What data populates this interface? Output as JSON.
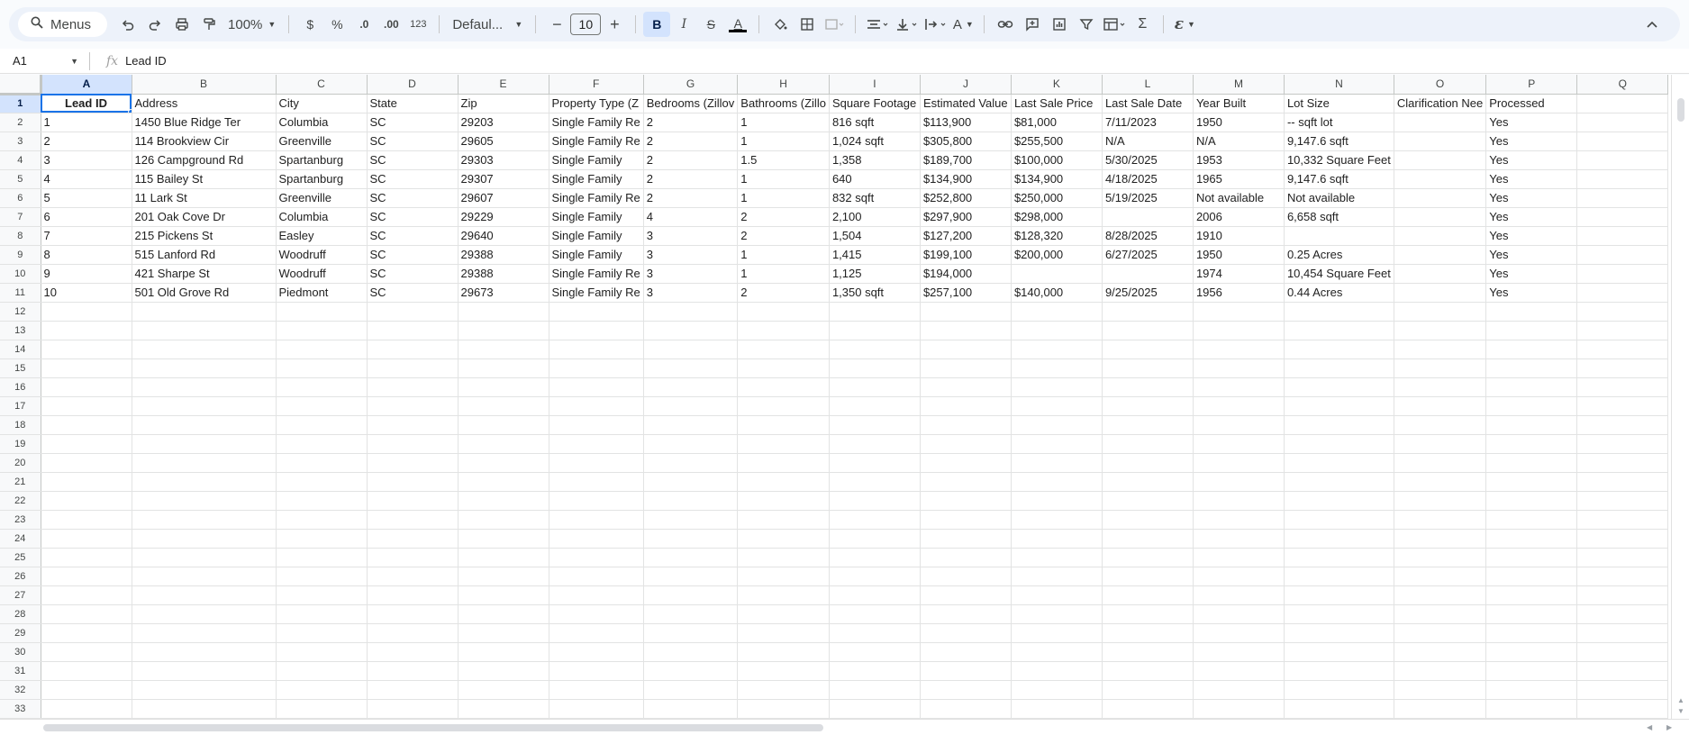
{
  "toolbar": {
    "menus_label": "Menus",
    "zoom": "100%",
    "currency": "$",
    "percent": "%",
    "decrease_decimal": ".0",
    "increase_decimal": ".00",
    "number_format": "123",
    "font": "Defaul...",
    "font_size": "10",
    "bold": "B",
    "italic": "I",
    "strike": "S",
    "text_color": "A",
    "text_rotation": "A",
    "functions": "Σ",
    "ai": "ε"
  },
  "formula_bar": {
    "cell_ref": "A1",
    "fx": "fx",
    "content": "Lead ID"
  },
  "columns": [
    "A",
    "B",
    "C",
    "D",
    "E",
    "F",
    "G",
    "H",
    "I",
    "J",
    "K",
    "L",
    "M",
    "N",
    "O",
    "P",
    "Q"
  ],
  "header_row": [
    "Lead ID",
    "Address",
    "City",
    "State",
    "Zip",
    "Property Type (Z",
    "Bedrooms (Zillov",
    "Bathrooms (Zillo",
    "Square Footage",
    "Estimated Value",
    "Last Sale Price",
    "Last Sale Date",
    "Year Built",
    "Lot Size",
    "Clarification Nee",
    "Processed",
    ""
  ],
  "rows": [
    [
      "1",
      "1450 Blue Ridge Ter",
      "Columbia",
      "SC",
      "29203",
      "Single Family Re",
      "2",
      "1",
      "816 sqft",
      "$113,900",
      "$81,000",
      "7/11/2023",
      "1950",
      "-- sqft lot",
      "",
      "Yes",
      ""
    ],
    [
      "2",
      "114 Brookview Cir",
      "Greenville",
      "SC",
      "29605",
      "Single Family Re",
      "2",
      "1",
      "1,024 sqft",
      "$305,800",
      "$255,500",
      "N/A",
      "N/A",
      "9,147.6 sqft",
      "",
      "Yes",
      ""
    ],
    [
      "3",
      "126 Campground Rd",
      "Spartanburg",
      "SC",
      "29303",
      "Single Family",
      "2",
      "1.5",
      "1,358",
      "$189,700",
      "$100,000",
      "5/30/2025",
      "1953",
      "10,332 Square Feet",
      "",
      "Yes",
      ""
    ],
    [
      "4",
      "115 Bailey St",
      "Spartanburg",
      "SC",
      "29307",
      "Single Family",
      "2",
      "1",
      "640",
      "$134,900",
      "$134,900",
      "4/18/2025",
      "1965",
      "9,147.6 sqft",
      "",
      "Yes",
      ""
    ],
    [
      "5",
      "11 Lark St",
      "Greenville",
      "SC",
      "29607",
      "Single Family Re",
      "2",
      "1",
      "832 sqft",
      "$252,800",
      "$250,000",
      "5/19/2025",
      "Not available",
      "Not available",
      "",
      "Yes",
      ""
    ],
    [
      "6",
      "201 Oak Cove Dr",
      "Columbia",
      "SC",
      "29229",
      "Single Family",
      "4",
      "2",
      "2,100",
      "$297,900",
      "$298,000",
      "",
      "2006",
      "6,658 sqft",
      "",
      "Yes",
      ""
    ],
    [
      "7",
      "215 Pickens St",
      "Easley",
      "SC",
      "29640",
      "Single Family",
      "3",
      "2",
      "1,504",
      "$127,200",
      "$128,320",
      "8/28/2025",
      "1910",
      "",
      "",
      "Yes",
      ""
    ],
    [
      "8",
      "515 Lanford Rd",
      "Woodruff",
      "SC",
      "29388",
      "Single Family",
      "3",
      "1",
      "1,415",
      "$199,100",
      "$200,000",
      "6/27/2025",
      "1950",
      "0.25 Acres",
      "",
      "Yes",
      ""
    ],
    [
      "9",
      "421 Sharpe St",
      "Woodruff",
      "SC",
      "29388",
      "Single Family Re",
      "3",
      "1",
      "1,125",
      "$194,000",
      "",
      "",
      "1974",
      "10,454 Square Feet",
      "",
      "Yes",
      ""
    ],
    [
      "10",
      "501 Old Grove Rd",
      "Piedmont",
      "SC",
      "29673",
      "Single Family Re",
      "3",
      "2",
      "1,350 sqft",
      "$257,100",
      "$140,000",
      "9/25/2025",
      "1956",
      "0.44 Acres",
      "",
      "Yes",
      ""
    ]
  ],
  "row_numbers": [
    "1",
    "2",
    "3",
    "4",
    "5",
    "6",
    "7",
    "8",
    "9",
    "10",
    "11",
    "12",
    "13",
    "14",
    "15",
    "16",
    "17",
    "18",
    "19",
    "20",
    "21",
    "22",
    "23",
    "24",
    "25",
    "26",
    "27",
    "28",
    "29",
    "30",
    "31",
    "32",
    "33"
  ],
  "colors": {
    "accent": "#1a73e8",
    "selection": "#d3e3fd",
    "toolbar_bg": "#edf2fa"
  }
}
